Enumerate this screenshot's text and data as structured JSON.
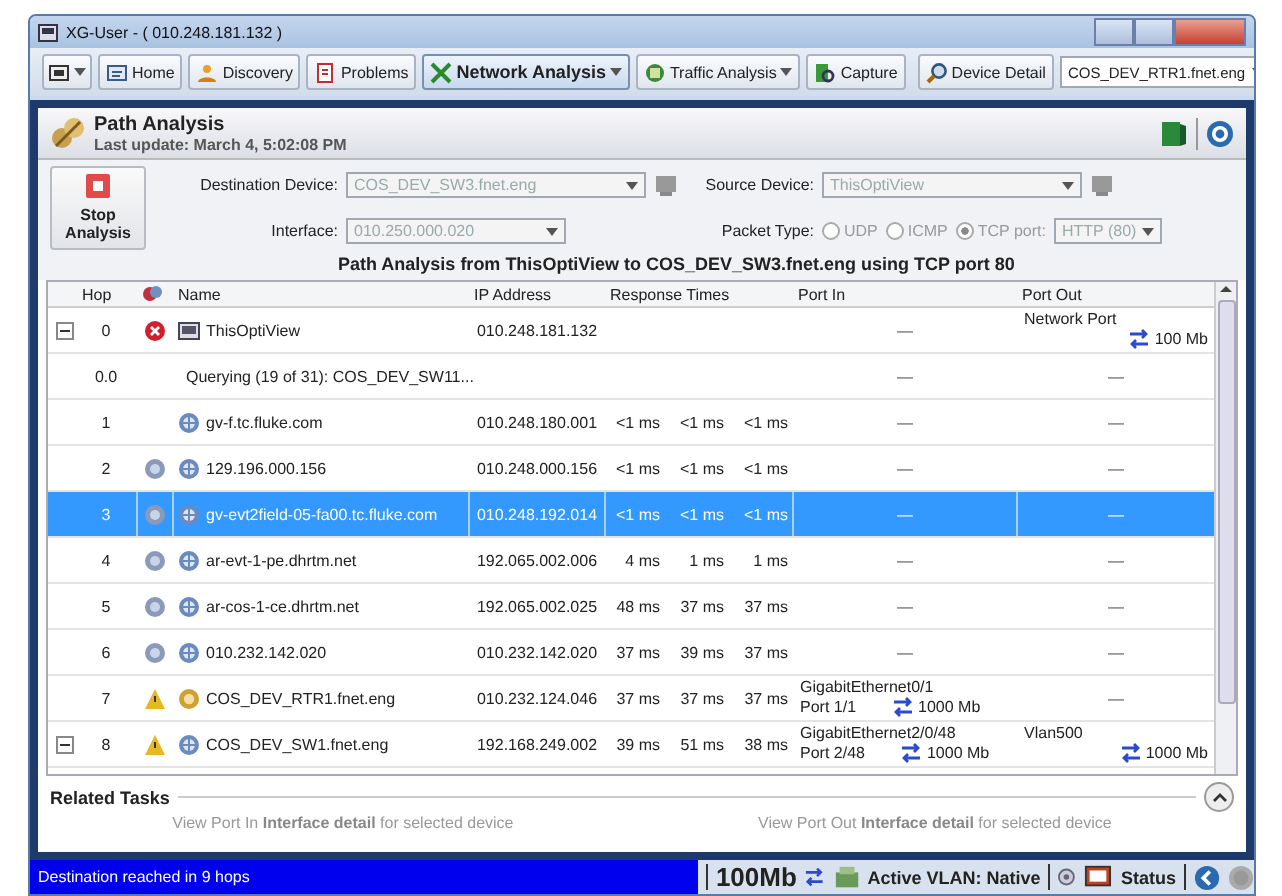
{
  "window": {
    "title": "XG-User - ( 010.248.181.132 )"
  },
  "toolbar": {
    "items": [
      {
        "kind": "menu",
        "dropdown": true,
        "selected": false
      },
      {
        "kind": "button",
        "label": "Home",
        "dropdown": false,
        "selected": false
      },
      {
        "kind": "button",
        "label": "Discovery",
        "dropdown": false,
        "selected": false
      },
      {
        "kind": "button",
        "label": "Problems",
        "dropdown": false,
        "selected": false
      },
      {
        "kind": "button",
        "label": "Network Analysis",
        "dropdown": true,
        "selected": true
      },
      {
        "kind": "button",
        "label": "Traffic Analysis",
        "dropdown": true,
        "selected": false
      },
      {
        "kind": "button",
        "label": "Capture",
        "dropdown": false,
        "selected": false
      }
    ],
    "device_detail": {
      "button": "Device Detail",
      "value": "COS_DEV_RTR1.fnet.eng"
    }
  },
  "panel": {
    "title": "Path Analysis",
    "subtitle": "Last update: March 4, 5:02:08 PM"
  },
  "controls": {
    "stop_button": "Stop Analysis",
    "disabled": true,
    "destination": {
      "label": "Destination Device:",
      "value": "COS_DEV_SW3.fnet.eng"
    },
    "source": {
      "label": "Source Device:",
      "value": "ThisOptiView"
    },
    "interface": {
      "label": "Interface:",
      "value": "010.250.000.020"
    },
    "packet_type": {
      "label": "Packet Type:",
      "options": [
        {
          "label": "UDP",
          "selected": false
        },
        {
          "label": "ICMP",
          "selected": false
        },
        {
          "label": "TCP port:",
          "selected": true
        }
      ],
      "port": "HTTP (80)"
    }
  },
  "summary": "Path Analysis from ThisOptiView to COS_DEV_SW3.fnet.eng using TCP port 80",
  "table": {
    "columns": [
      "Hop",
      "Name",
      "IP Address",
      "Response Times",
      "Port In",
      "Port Out"
    ],
    "rows": [
      {
        "kind": "local",
        "expanded": true,
        "error": true,
        "warning": false,
        "info": false,
        "hop": "0",
        "name": "ThisOptiView",
        "ip": "010.248.181.132",
        "port_in": "—",
        "port_out": {
          "interface": "Network Port",
          "speed": "100 Mb"
        },
        "selected": false
      },
      {
        "kind": "query",
        "error": false,
        "warning": false,
        "info": false,
        "hop": "0.0",
        "name": "Querying (19 of 31): COS_DEV_SW11...",
        "port_in": "—",
        "port_out": "—",
        "selected": false
      },
      {
        "kind": "host",
        "error": false,
        "warning": false,
        "info": false,
        "hop": "1",
        "name": "gv-f.tc.fluke.com",
        "ip": "010.248.180.001",
        "times": [
          "<1 ms",
          "<1 ms",
          "<1 ms"
        ],
        "port_in": "—",
        "port_out": "—",
        "selected": false
      },
      {
        "kind": "host",
        "error": false,
        "warning": false,
        "info": true,
        "hop": "2",
        "name": "129.196.000.156",
        "ip": "010.248.000.156",
        "times": [
          "<1 ms",
          "<1 ms",
          "<1 ms"
        ],
        "port_in": "—",
        "port_out": "—",
        "selected": false
      },
      {
        "kind": "host",
        "error": false,
        "warning": false,
        "info": true,
        "hop": "3",
        "name": "gv-evt2field-05-fa00.tc.fluke.com",
        "ip": "010.248.192.014",
        "times": [
          "<1 ms",
          "<1 ms",
          "<1 ms"
        ],
        "port_in": "—",
        "port_out": "—",
        "selected": true
      },
      {
        "kind": "host",
        "error": false,
        "warning": false,
        "info": true,
        "hop": "4",
        "name": "ar-evt-1-pe.dhrtm.net",
        "ip": "192.065.002.006",
        "times": [
          "4 ms",
          "1 ms",
          "1 ms"
        ],
        "port_in": "—",
        "port_out": "—",
        "selected": false
      },
      {
        "kind": "host",
        "error": false,
        "warning": false,
        "info": true,
        "hop": "5",
        "name": "ar-cos-1-ce.dhrtm.net",
        "ip": "192.065.002.025",
        "times": [
          "48 ms",
          "37 ms",
          "37 ms"
        ],
        "port_in": "—",
        "port_out": "—",
        "selected": false
      },
      {
        "kind": "host",
        "error": false,
        "warning": false,
        "info": true,
        "hop": "6",
        "name": "010.232.142.020",
        "ip": "010.232.142.020",
        "times": [
          "37 ms",
          "39 ms",
          "37 ms"
        ],
        "port_in": "—",
        "port_out": "—",
        "selected": false
      },
      {
        "kind": "router",
        "error": false,
        "warning": true,
        "info": false,
        "hop": "7",
        "name": "COS_DEV_RTR1.fnet.eng",
        "ip": "010.232.124.046",
        "times": [
          "37 ms",
          "37 ms",
          "37 ms"
        ],
        "port_in": {
          "interface": "GigabitEthernet0/1",
          "port": "Port 1/1",
          "speed": "1000 Mb"
        },
        "port_out": "—",
        "selected": false
      },
      {
        "kind": "host",
        "expanded": true,
        "error": false,
        "warning": true,
        "info": false,
        "hop": "8",
        "name": "COS_DEV_SW1.fnet.eng",
        "ip": "192.168.249.002",
        "times": [
          "39 ms",
          "51 ms",
          "38 ms"
        ],
        "port_in": {
          "interface": "GigabitEthernet2/0/48",
          "port": "Port 2/48",
          "speed": "1000 Mb"
        },
        "port_out": {
          "interface": "Vlan500",
          "speed": "1000 Mb"
        },
        "selected": false
      }
    ]
  },
  "related_tasks": {
    "title": "Related Tasks",
    "expanded": true,
    "links": [
      "View Port In **Interface detail** for selected device",
      "View Port Out **Interface detail** for selected device"
    ]
  },
  "status_bar": {
    "message": "Destination reached in 9 hops",
    "speed": "100Mb",
    "vlan": "Active VLAN: Native",
    "status": "Status"
  }
}
